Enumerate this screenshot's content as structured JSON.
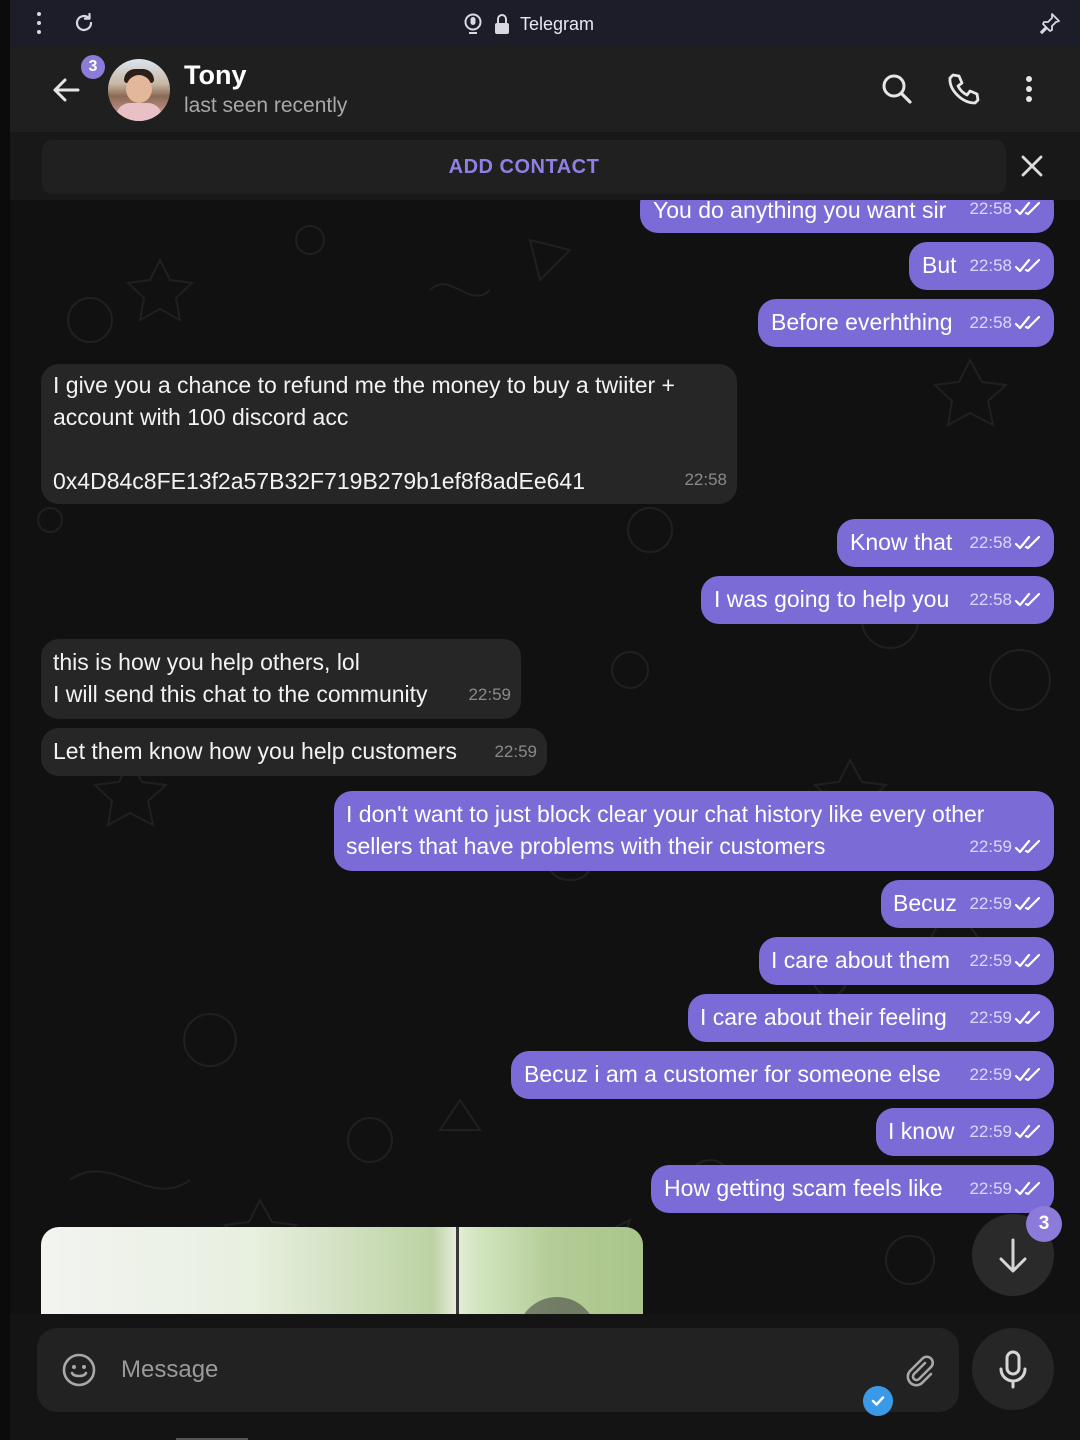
{
  "browser": {
    "title": "Telegram",
    "icons": [
      "menu-dots-icon",
      "reload-icon",
      "camera-mic-icon",
      "lock-icon",
      "pin-icon"
    ]
  },
  "header": {
    "unread_count": "3",
    "contact_name": "Tony",
    "status": "last seen recently",
    "icons": [
      "back-arrow-icon",
      "search-icon",
      "phone-icon",
      "more-vertical-icon"
    ]
  },
  "add_contact": {
    "label": "ADD CONTACT",
    "close_icon": "close-icon"
  },
  "messages": [
    {
      "dir": "out",
      "text": "You do anything you want sir",
      "time": "22:58",
      "read": true
    },
    {
      "dir": "out",
      "text": "But",
      "time": "22:58",
      "read": true
    },
    {
      "dir": "out",
      "text": "Before everhthing",
      "time": "22:58",
      "read": true
    },
    {
      "dir": "in",
      "text": "I give you a chance to refund me the money to buy a twiiter +\naccount with 100 discord acc\n\n0x4D84c8FE13f2a57B32F719B279b1ef8f8adEe641",
      "time": "22:58"
    },
    {
      "dir": "out",
      "text": "Know that",
      "time": "22:58",
      "read": true
    },
    {
      "dir": "out",
      "text": "I was going to help you",
      "time": "22:58",
      "read": true
    },
    {
      "dir": "in",
      "text": "this is how you help others, lol\nI will send this chat to the community",
      "time": "22:59"
    },
    {
      "dir": "in",
      "text": "Let them know how you help customers",
      "time": "22:59"
    },
    {
      "dir": "out",
      "text": "I don't want to just block clear your chat history like every other\nsellers that have problems with their customers",
      "time": "22:59",
      "read": true
    },
    {
      "dir": "out",
      "text": "Becuz",
      "time": "22:59",
      "read": true
    },
    {
      "dir": "out",
      "text": "I care about them",
      "time": "22:59",
      "read": true
    },
    {
      "dir": "out",
      "text": "I care about their feeling",
      "time": "22:59",
      "read": true
    },
    {
      "dir": "out",
      "text": "Becuz i am a customer for someone else",
      "time": "22:59",
      "read": true
    },
    {
      "dir": "out",
      "text": "I know",
      "time": "22:59",
      "read": true
    },
    {
      "dir": "out",
      "text": "How getting scam feels like",
      "time": "22:59",
      "read": true
    }
  ],
  "scroll_down": {
    "badge": "3",
    "icon": "arrow-down-icon"
  },
  "composer": {
    "placeholder": "Message",
    "icons": [
      "emoji-icon",
      "attach-icon",
      "checkmark-badge-icon",
      "microphone-icon"
    ]
  },
  "colors": {
    "outgoing_bubble": "#7b6bd6",
    "incoming_bubble": "#262626",
    "accent": "#8c7bd8",
    "add_contact_text": "#8f80e6",
    "background": "#111111"
  }
}
